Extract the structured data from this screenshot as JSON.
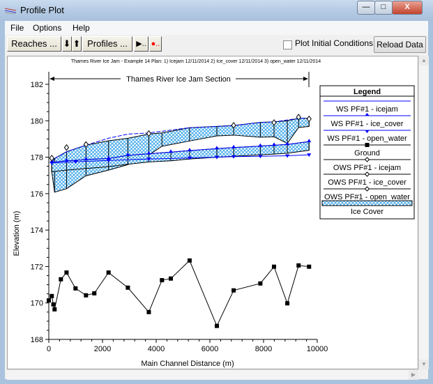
{
  "window": {
    "title": "Profile Plot",
    "minimize": "—",
    "maximize": "□",
    "close": "X"
  },
  "menu": [
    {
      "label": "File"
    },
    {
      "label": "Options"
    },
    {
      "label": "Help"
    }
  ],
  "toolbar": {
    "reaches": "Reaches ...",
    "down_arrow": "⬇",
    "up_arrow": "⬆",
    "profiles": "Profiles ...",
    "play": "▶..",
    "record": "●..",
    "plot_initial_conditions": "Plot Initial Conditions",
    "plot_initial_conditions_checked": false,
    "reload": "Reload Data"
  },
  "colors": {
    "ws": "#0000ff",
    "ground": "#000000",
    "ice_hatch": "#3ba6ea"
  },
  "chart_data": {
    "type": "line",
    "header": "Thames River Ice Jam - Example 14      Plan:    1) Icejam     12/11/2014     2) Ice_cover     12/11/2014     3) open_water     12/11/2014",
    "annotation": "Thames River Ice Jam Section",
    "xlabel": "Main Channel Distance (m)",
    "ylabel": "Elevation (m)",
    "xlim": [
      0,
      10000
    ],
    "ylim": [
      168,
      182
    ],
    "xticks": [
      "0",
      "2000",
      "4000",
      "6000",
      "8000",
      "10000"
    ],
    "yticks": [
      "168",
      "170",
      "172",
      "174",
      "176",
      "178",
      "180",
      "182"
    ],
    "legend": {
      "title": "Legend",
      "position": "right",
      "entries": [
        "WS  PF#1 - icejam",
        "WS  PF#1 - ice_cover",
        "WS  PF#1 - open_water",
        "Ground",
        "OWS  PF#1 - icejam",
        "OWS  PF#1 - ice_cover",
        "OWS  PF#1 - open_water",
        "Ice Cover"
      ]
    },
    "series": [
      {
        "name": "Ground",
        "x": [
          0,
          110,
          170,
          215,
          450,
          660,
          995,
          1385,
          1695,
          2225,
          2945,
          3725,
          4215,
          4545,
          5245,
          6260,
          6885,
          7880,
          8390,
          8885,
          9305,
          9695
        ],
        "y": [
          170.14,
          170.38,
          169.92,
          169.65,
          171.3,
          171.67,
          170.8,
          170.42,
          170.53,
          171.67,
          170.84,
          169.5,
          171.25,
          171.34,
          172.33,
          168.74,
          170.69,
          171.07,
          171.99,
          169.98,
          172.06,
          171.99
        ]
      },
      {
        "name": "WS  PF#1 - icejam",
        "x": [
          110,
          215,
          660,
          1385,
          2225,
          2945,
          3725,
          5245,
          6260,
          6885,
          7880,
          8390,
          9305,
          9695
        ],
        "y": [
          177.68,
          177.93,
          178.3,
          178.66,
          179.04,
          179.27,
          179.33,
          179.62,
          179.69,
          179.74,
          179.91,
          179.94,
          180.13,
          180.14
        ]
      },
      {
        "name": "WS  PF#1 - ice_cover",
        "x": [
          110,
          660,
          1385,
          2225,
          2945,
          3725,
          4545,
          5245,
          6260,
          6885,
          7880,
          8390,
          8885,
          9695
        ],
        "y": [
          177.72,
          177.8,
          177.87,
          177.93,
          178.1,
          178.19,
          178.28,
          178.36,
          178.47,
          178.53,
          178.61,
          178.66,
          178.7,
          178.86
        ]
      },
      {
        "name": "WS  PF#1 - open_water",
        "x": [
          110,
          1000,
          2225,
          3725,
          5245,
          6260,
          6885,
          7880,
          8885,
          9695
        ],
        "y": [
          177.68,
          177.75,
          177.82,
          177.9,
          177.96,
          178.0,
          178.03,
          178.05,
          178.08,
          178.13
        ]
      },
      {
        "name": "OWS  PF#1 - icejam",
        "x": [
          110,
          660,
          1385,
          3725,
          6885,
          8390,
          9305,
          9695
        ],
        "y": [
          177.95,
          178.53,
          178.7,
          179.3,
          179.75,
          179.9,
          180.2,
          180.1
        ]
      }
    ],
    "ice_cover": [
      {
        "profile": "icejam",
        "x": [
          110,
          215,
          660,
          1385,
          2225,
          2945,
          3725,
          4215,
          5245,
          6260,
          6885,
          7880,
          8390,
          8885,
          9305,
          9695
        ],
        "top": [
          177.68,
          177.93,
          178.3,
          178.66,
          178.9,
          179.04,
          179.27,
          179.33,
          179.62,
          179.69,
          179.74,
          179.91,
          179.94,
          180.0,
          180.13,
          180.14
        ],
        "bottom": [
          177.2,
          176.08,
          176.27,
          176.98,
          177.29,
          177.59,
          178.12,
          178.6,
          178.89,
          179.17,
          179.21,
          179.1,
          179.12,
          178.76,
          179.63,
          179.69
        ]
      },
      {
        "profile": "ice_cover",
        "x": [
          110,
          660,
          1385,
          2225,
          2945,
          3725,
          4545,
          5245,
          6260,
          6885,
          7880,
          8390,
          8885,
          9695
        ],
        "top": [
          177.72,
          177.8,
          177.87,
          177.93,
          178.1,
          178.19,
          178.28,
          178.36,
          178.47,
          178.53,
          178.61,
          178.66,
          178.7,
          178.86
        ],
        "bottom": [
          177.2,
          177.29,
          177.38,
          177.48,
          177.61,
          177.74,
          177.8,
          177.9,
          178.0,
          178.05,
          178.13,
          178.17,
          178.22,
          178.38
        ]
      }
    ]
  }
}
